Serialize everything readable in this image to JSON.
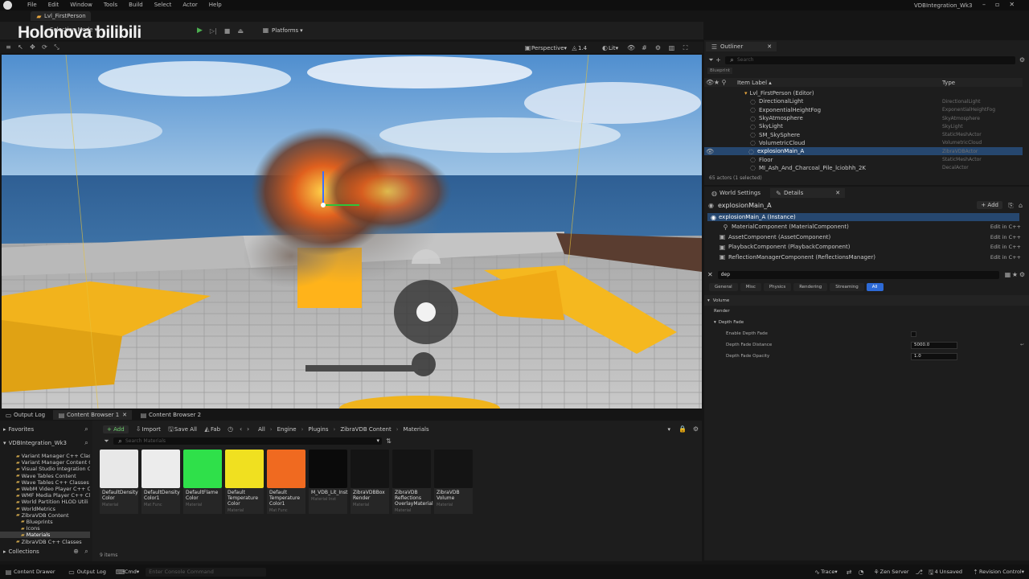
{
  "menu": [
    "File",
    "Edit",
    "Window",
    "Tools",
    "Build",
    "Select",
    "Actor",
    "Help"
  ],
  "window_title": "VDBIntegration_Wk3",
  "level_tab": "Lvl_FirstPerson",
  "watermark": "Holonova bilibili",
  "toolbar": {
    "selection_mode": "Selection Mode",
    "platforms": "Platforms"
  },
  "viewport": {
    "perspective": "Perspective",
    "fov": "1.4",
    "lit": "Lit"
  },
  "outliner": {
    "title": "Outliner",
    "search_placeholder": "Search",
    "blueprint_tag": "Blueprint",
    "col_label": "Item Label ▴",
    "col_type": "Type",
    "root": "Lvl_FirstPerson (Editor)",
    "rows": [
      {
        "name": "DirectionalLight",
        "type": "DirectionalLight"
      },
      {
        "name": "ExponentialHeightFog",
        "type": "ExponentialHeightFog"
      },
      {
        "name": "SkyAtmosphere",
        "type": "SkyAtmosphere"
      },
      {
        "name": "SkyLight",
        "type": "SkyLight"
      },
      {
        "name": "SM_SkySphere",
        "type": "StaticMeshActor"
      },
      {
        "name": "VolumetricCloud",
        "type": "VolumetricCloud"
      },
      {
        "name": "explosionMain_A",
        "type": "ZibraVDBActor"
      },
      {
        "name": "Floor",
        "type": "StaticMeshActor"
      },
      {
        "name": "MI_Ash_And_Charcoal_Pile_lciobhh_2K",
        "type": "DecalActor"
      }
    ],
    "status": "65 actors (1 selected)"
  },
  "details": {
    "tab_world": "World Settings",
    "tab_details": "Details",
    "actor_name": "explosionMain_A",
    "add_label": "+ Add",
    "instance": "explosionMain_A (Instance)",
    "components": [
      {
        "name": "MaterialComponent (MaterialComponent)",
        "edit": "Edit in C++"
      },
      {
        "name": "AssetComponent (AssetComponent)",
        "edit": "Edit in C++"
      },
      {
        "name": "PlaybackComponent (PlaybackComponent)",
        "edit": "Edit in C++"
      },
      {
        "name": "ReflectionManagerComponent (ReflectionsManager)",
        "edit": "Edit in C++"
      }
    ],
    "search_value": "dep",
    "filters": [
      "General",
      "Misc",
      "Physics",
      "Rendering",
      "Streaming",
      "All"
    ],
    "section_volume": "Volume",
    "section_render": "Render",
    "section_depth": "Depth Fade",
    "props": [
      {
        "label": "Enable Depth Fade",
        "value": ""
      },
      {
        "label": "Depth Fade Distance",
        "value": "5000.0"
      },
      {
        "label": "Depth Fade Opacity",
        "value": "1.0"
      }
    ]
  },
  "bottom_tabs": [
    "Output Log",
    "Content Browser 1",
    "Content Browser 2"
  ],
  "content_browser": {
    "favorites": "Favorites",
    "project": "VDBIntegration_Wk3",
    "tree": [
      "Variant Manager C++ Classes",
      "Variant Manager Content C",
      "Visual Studio Integration C",
      "Wave Tables Content",
      "Wave Tables C++ Classes",
      "WebM Video Player C++ Cl",
      "WMF Media Player C++ Cla",
      "World Partition HLOD Utili",
      "WorldMetrics",
      "ZibraVDB Content",
      "Blueprints",
      "Icons",
      "Materials",
      "ZibraVDB C++ Classes"
    ],
    "collections": "Collections",
    "add": "+ Add",
    "import": "Import",
    "save_all": "Save All",
    "fab": "Fab",
    "breadcrumb": [
      "All",
      "Engine",
      "Plugins",
      "ZibraVDB Content",
      "Materials"
    ],
    "search_placeholder": "Search Materials",
    "assets": [
      {
        "name": "DefaultDensity Color",
        "sub": "Material",
        "color": "#e8e8e8"
      },
      {
        "name": "DefaultDensity Color1",
        "sub": "Mat Func",
        "color": "#ececec"
      },
      {
        "name": "DefaultFlame Color",
        "sub": "Material",
        "color": "#2fe04a"
      },
      {
        "name": "Default Temperature Color",
        "sub": "Material",
        "color": "#f0e020"
      },
      {
        "name": "Default Temperature Color1",
        "sub": "Mat Func",
        "color": "#f06a20"
      },
      {
        "name": "M_VDB_Lit_Inst",
        "sub": "Material Inst",
        "color": "#0a0a0a"
      },
      {
        "name": "ZibraVDBBox Render",
        "sub": "Material",
        "color": "#141414"
      },
      {
        "name": "ZibraVDB Reflections OverlayMaterial",
        "sub": "Material",
        "color": "#141414"
      },
      {
        "name": "ZibraVDB Volume",
        "sub": "Material",
        "color": "#141414"
      }
    ],
    "item_count": "9 items"
  },
  "statusbar": {
    "content_drawer": "Content Drawer",
    "output_log": "Output Log",
    "cmd": "Cmd",
    "console_placeholder": "Enter Console Command",
    "trace": "Trace",
    "zen": "Zen Server",
    "unsaved": "4 Unsaved",
    "revision": "Revision Control"
  }
}
